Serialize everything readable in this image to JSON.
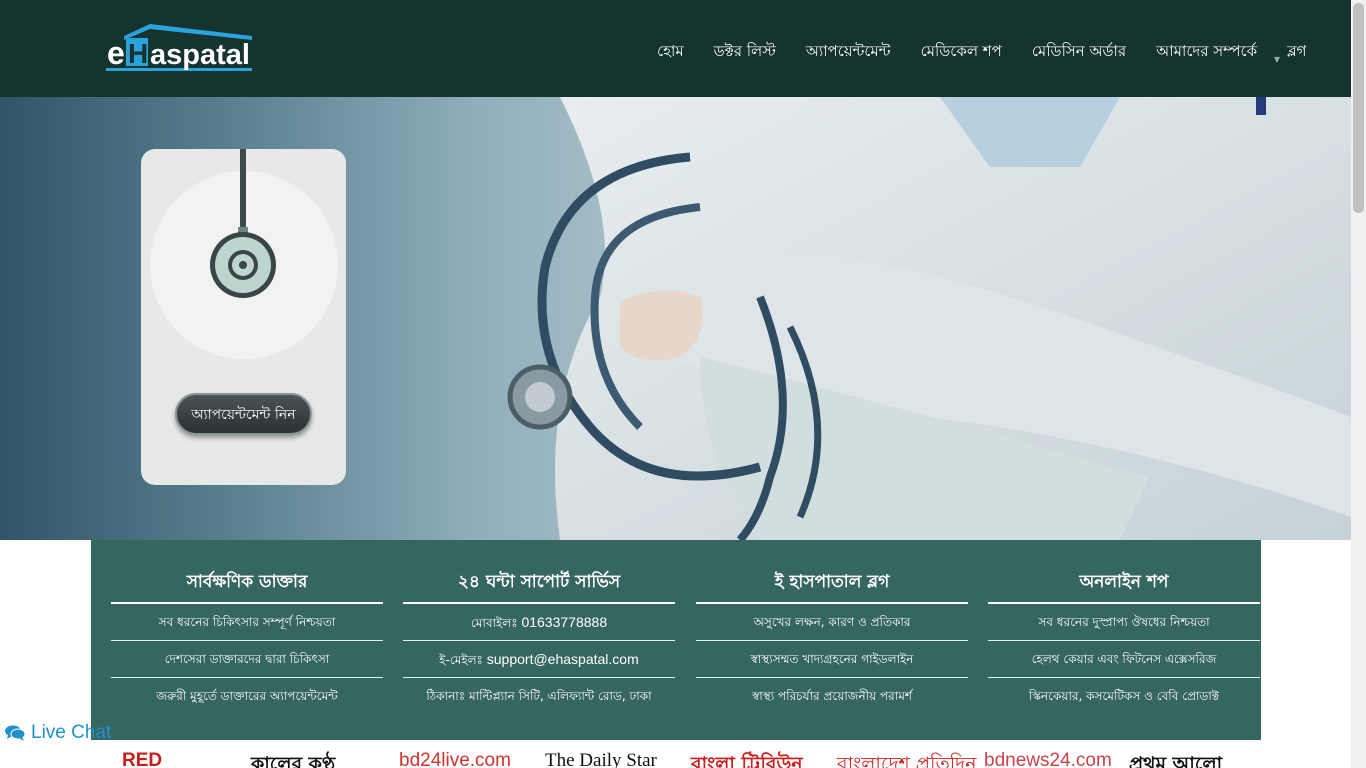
{
  "header": {
    "logo_text_e": "e",
    "logo_text_h": "H",
    "logo_text_rest": "aspatal",
    "nav": [
      "হোম",
      "ডক্টর লিস্ট",
      "অ্যাপয়েন্টমেন্ট",
      "মেডিকেল শপ",
      "মেডিসিন অর্ডার",
      "আমাদের সম্পর্কে",
      "ব্লগ"
    ]
  },
  "hero": {
    "appointment_button": "অ্যাপয়েন্টমেন্ট নিন"
  },
  "features": [
    {
      "title": "সার্বক্ষণিক ডাক্তার",
      "items": [
        "সব ধরনের চিকিৎসার সম্পূর্ণ নিশ্চয়তা",
        "দেশসেরা ডাক্তারদের দ্বারা চিকিৎসা",
        "জরুরী মুহূর্তে ডাক্তারের অ্যাপয়েন্টমেন্ট"
      ]
    },
    {
      "title": "২৪ ঘন্টা সাপোর্ট সার্ভিস",
      "items": [
        {
          "label": "মোবাইলঃ ",
          "value": "01633778888"
        },
        {
          "label": "ই-মেইলঃ ",
          "value": "support@ehaspatal.com"
        },
        {
          "label": "ঠিকানাঃ ",
          "value": "মাল্টিপ্ল্যান সিটি, এলিফ্যান্ট রোড, ঢাকা"
        }
      ]
    },
    {
      "title": "ই হাসপাতাল ব্লগ",
      "items": [
        "অসুখের লক্ষন, কারণ ও প্রতিকার",
        "স্বাস্থ্যসম্মত খাদ্যগ্রহনের গাইডলাইন",
        "স্বাস্থ্য পরিচর্যার প্রয়োজনীয় পরামর্শ"
      ]
    },
    {
      "title": "অনলাইন শপ",
      "items": [
        "সব ধরনের দুস্প্রাপ্য ঔষধের নিশ্চয়তা",
        "হেলথ কেয়ার এবং ফিটনেস এক্সেসরিজ",
        "স্কিনকেয়ার, কসমেটিকস ও বেবি প্রোডাক্ট"
      ]
    }
  ],
  "live_chat": "Live Chat",
  "media_logos": [
    "RED",
    "কালের কণ্ঠ",
    "bd24live.com",
    "The Daily Star",
    "বাংলা ট্রিবিউন",
    "বাংলাদেশ প্রতিদিন",
    "bdnews24.com",
    "প্রথম আলো"
  ],
  "colors": {
    "header_bg": "#15332f",
    "panel_bg": "#366660",
    "logo_blue": "#2aa3dc",
    "chat_blue": "#1f8fcf"
  }
}
